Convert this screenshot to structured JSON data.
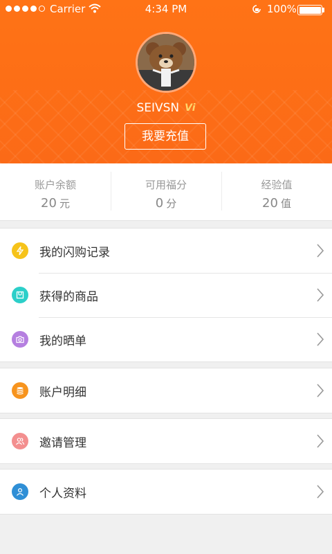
{
  "status_bar": {
    "carrier": "Carrier",
    "time": "4:34 PM",
    "battery": "100%"
  },
  "profile": {
    "username": "SEIVSN",
    "vip_badge": "Vi",
    "recharge_label": "我要充值"
  },
  "stats": [
    {
      "label": "账户余额",
      "value": "20",
      "unit": "元"
    },
    {
      "label": "可用福分",
      "value": "0",
      "unit": "分"
    },
    {
      "label": "经验值",
      "value": "20",
      "unit": "值"
    }
  ],
  "menu": {
    "group1": [
      {
        "label": "我的闪购记录",
        "icon": "lightning-icon",
        "color": "#f6c31a"
      },
      {
        "label": "获得的商品",
        "icon": "bag-icon",
        "color": "#2ccfc9"
      },
      {
        "label": "我的晒单",
        "icon": "camera-icon",
        "color": "#b57fe0"
      }
    ],
    "group2": [
      {
        "label": "账户明细",
        "icon": "coins-icon",
        "color": "#f7941e"
      }
    ],
    "group3": [
      {
        "label": "邀请管理",
        "icon": "users-icon",
        "color": "#f38f8f"
      }
    ],
    "group4": [
      {
        "label": "个人资料",
        "icon": "person-icon",
        "color": "#2f8fd6"
      }
    ]
  },
  "colors": {
    "header": "#fb6a17",
    "background": "#f0f0f0"
  }
}
